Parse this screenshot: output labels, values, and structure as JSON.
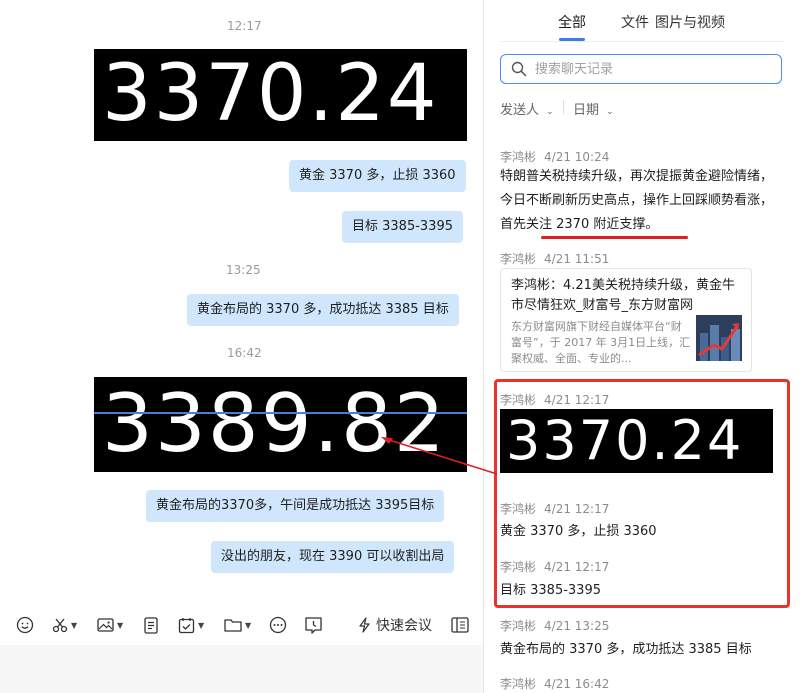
{
  "chat": {
    "messages": [
      {
        "time": "12:17"
      },
      {
        "image_text": "3370.24"
      },
      {
        "text": "黄金 3370 多，止损 3360"
      },
      {
        "text": "目标 3385-3395"
      },
      {
        "time": "13:25"
      },
      {
        "text": "黄金布局的 3370 多，成功抵达 3385 目标"
      },
      {
        "time": "16:42"
      },
      {
        "image_text": "3389.82"
      },
      {
        "text": "黄金布局的3370多，午间是成功抵达 3395目标"
      },
      {
        "text": "没出的朋友，现在 3390 可以收割出局"
      }
    ],
    "toolbar": {
      "quick_meeting_label": "快速会议",
      "icons": [
        "emoji-icon",
        "scissors-icon",
        "image-icon",
        "document-icon",
        "task-icon",
        "folder-icon",
        "more-icon",
        "chat-record-icon",
        "lightning-icon",
        "sidebar-icon"
      ]
    }
  },
  "history": {
    "tabs": [
      {
        "label": "全部",
        "active": true
      },
      {
        "label": "文件",
        "active": false
      },
      {
        "label": "图片与视频",
        "active": false
      }
    ],
    "search": {
      "placeholder": "搜索聊天记录"
    },
    "filters": {
      "sender": "发送人",
      "date": "日期"
    },
    "items": [
      {
        "sender": "李鸿彬",
        "time": "4/21 10:24",
        "text": "特朗普关税持续升级，再次提振黄金避险情绪，今日不断刷新历史高点，操作上回踩顺势看涨，首先关注 2370 附近支撑。"
      },
      {
        "sender": "李鸿彬",
        "time": "4/21 11:51",
        "card": {
          "title": "李鸿彬：4.21美关税持续升级，黄金牛市尽情狂欢_财富号_东方财富网",
          "desc": "东方财富网旗下财经自媒体平台“财富号”，于 2017 年 3月1日上线，汇聚权威、全面、专业的..."
        }
      },
      {
        "sender": "李鸿彬",
        "time": "4/21 12:17",
        "image_text": "3370.24"
      },
      {
        "sender": "李鸿彬",
        "time": "4/21 12:17",
        "text": "黄金 3370 多，止损 3360"
      },
      {
        "sender": "李鸿彬",
        "time": "4/21 12:17",
        "text": "目标 3385-3395"
      },
      {
        "sender": "李鸿彬",
        "time": "4/21 13:25",
        "text": "黄金布局的 3370 多，成功抵达 3385 目标"
      },
      {
        "sender": "李鸿彬",
        "time": "4/21 16:42"
      }
    ]
  },
  "colors": {
    "bubble": "#cfe6fc",
    "accent": "#3b7de9",
    "highlight": "#e8332c"
  }
}
